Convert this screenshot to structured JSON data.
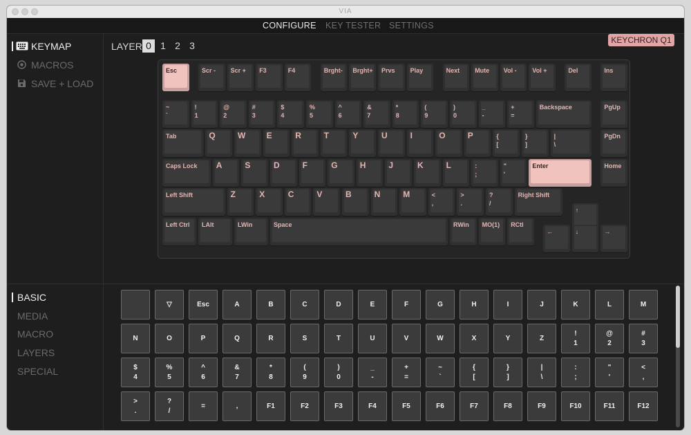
{
  "window": {
    "title": "VIA"
  },
  "topnav": {
    "tabs": [
      "CONFIGURE",
      "KEY TESTER",
      "SETTINGS"
    ],
    "active": "CONFIGURE"
  },
  "sidebar": {
    "items": [
      "KEYMAP",
      "MACROS",
      "SAVE + LOAD"
    ],
    "active": "KEYMAP",
    "icons": [
      "keyboard-icon",
      "macros-icon",
      "floppy-disk-icon"
    ]
  },
  "layer": {
    "label": "LAYER",
    "options": [
      "0",
      "1",
      "2",
      "3"
    ],
    "selected": "0"
  },
  "device": {
    "name": "KEYCHRON Q1"
  },
  "keyboard": {
    "rows": [
      [
        "Esc",
        "Scr -",
        "Scr +",
        "F3",
        "F4",
        "Brght-",
        "Brght+",
        "Prvs",
        "Play",
        "Next",
        "Mute",
        "Vol -",
        "Vol +",
        "Del",
        "Ins"
      ],
      [
        "~\n`",
        "!\n1",
        "@\n2",
        "#\n3",
        "$\n4",
        "%\n5",
        "^\n6",
        "&\n7",
        "*\n8",
        "(\n9",
        ")\n0",
        "_\n-",
        "+\n=",
        "Backspace",
        "PgUp"
      ],
      [
        "Tab",
        "Q",
        "W",
        "E",
        "R",
        "T",
        "Y",
        "U",
        "I",
        "O",
        "P",
        "{\n[",
        "}\n]",
        "|\n\\",
        "PgDn"
      ],
      [
        "Caps Lock",
        "A",
        "S",
        "D",
        "F",
        "G",
        "H",
        "J",
        "K",
        "L",
        ":\n;",
        "\"\n'",
        "Enter",
        "Home"
      ],
      [
        "Left Shift",
        "Z",
        "X",
        "C",
        "V",
        "B",
        "N",
        "M",
        "<\n,",
        ">\n.",
        "?\n/",
        "Right Shift",
        "↑"
      ],
      [
        "Left Ctrl",
        "LAlt",
        "LWin",
        "Space",
        "RWin",
        "MO(1)",
        "RCtl",
        "←",
        "↓",
        "→"
      ]
    ],
    "selected_keys": [
      "Esc",
      "Enter"
    ],
    "colors": {
      "keycap": "#3a3a3a",
      "legend": "#e2b6b2",
      "selected": "#f0c3bf",
      "accent": "#e0a5a4"
    }
  },
  "categories": {
    "items": [
      "BASIC",
      "MEDIA",
      "MACRO",
      "LAYERS",
      "SPECIAL"
    ],
    "active": "BASIC"
  },
  "palette": {
    "rows": [
      [
        "",
        "▽",
        "Esc",
        "A",
        "B",
        "C",
        "D",
        "E",
        "F",
        "G",
        "H",
        "I",
        "J",
        "K",
        "L",
        "M"
      ],
      [
        "N",
        "O",
        "P",
        "Q",
        "R",
        "S",
        "T",
        "U",
        "V",
        "W",
        "X",
        "Y",
        "Z",
        "!\n1",
        "@\n2",
        "#\n3"
      ],
      [
        "$\n4",
        "%\n5",
        "^\n6",
        "&\n7",
        "*\n8",
        "(\n9",
        ")\n0",
        "_\n-",
        "+\n=",
        "~\n`",
        "{\n[",
        "}\n]",
        "|\n\\",
        ":\n;",
        "\"\n'",
        "<\n,"
      ],
      [
        ">\n.",
        "?\n/",
        "=",
        ",",
        "F1",
        "F2",
        "F3",
        "F4",
        "F5",
        "F6",
        "F7",
        "F8",
        "F9",
        "F10",
        "F11",
        "F12"
      ]
    ]
  }
}
